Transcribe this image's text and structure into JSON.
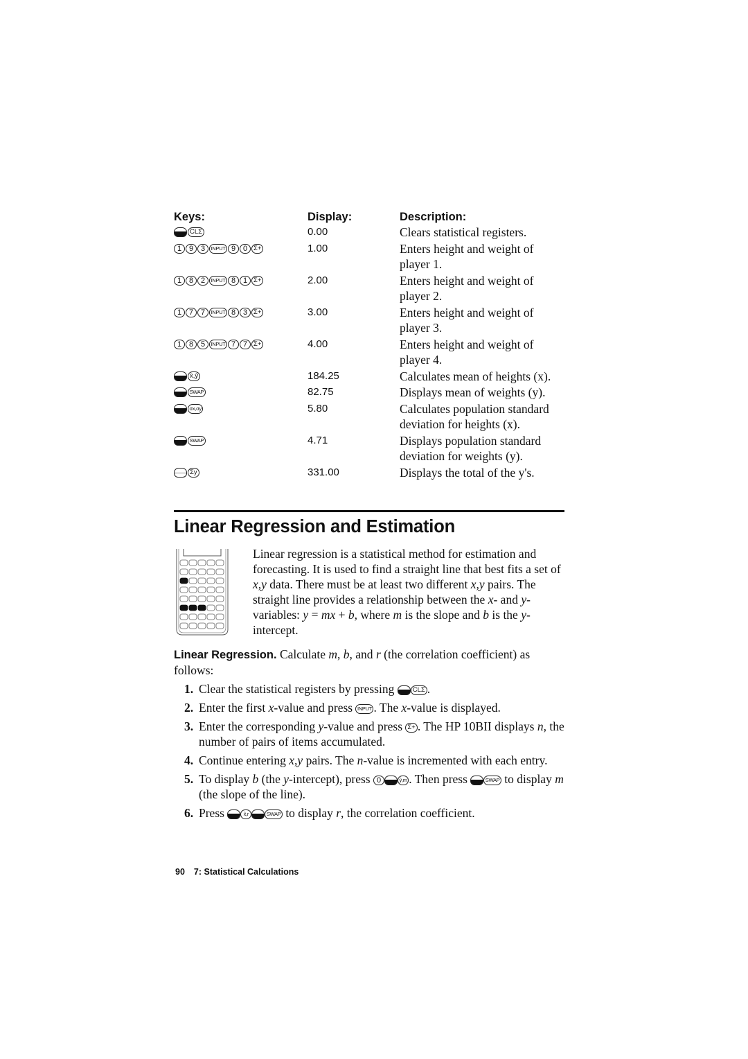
{
  "table": {
    "headers": {
      "keys": "Keys:",
      "display": "Display:",
      "description": "Description:"
    },
    "rows": [
      {
        "keys": [
          {
            "type": "shift"
          },
          {
            "label": "CLΣ",
            "size": "mid"
          }
        ],
        "display": "0.00",
        "description": "Clears statistical registers."
      },
      {
        "keys": [
          {
            "label": "1"
          },
          {
            "label": "9"
          },
          {
            "label": "3"
          },
          {
            "label": "INPUT",
            "size": "small"
          },
          {
            "label": "9"
          },
          {
            "label": "0"
          },
          {
            "label": "Σ+",
            "size": "mid"
          }
        ],
        "display": "1.00",
        "description": "Enters height and weight of player 1."
      },
      {
        "keys": [
          {
            "label": "1"
          },
          {
            "label": "8"
          },
          {
            "label": "2"
          },
          {
            "label": "INPUT",
            "size": "small"
          },
          {
            "label": "8"
          },
          {
            "label": "1"
          },
          {
            "label": "Σ+",
            "size": "mid"
          }
        ],
        "display": "2.00",
        "description": "Enters height and weight of player 2."
      },
      {
        "keys": [
          {
            "label": "1"
          },
          {
            "label": "7"
          },
          {
            "label": "7"
          },
          {
            "label": "INPUT",
            "size": "small"
          },
          {
            "label": "8"
          },
          {
            "label": "3"
          },
          {
            "label": "Σ+",
            "size": "mid"
          }
        ],
        "display": "3.00",
        "description": "Enters height and weight of player 3."
      },
      {
        "keys": [
          {
            "label": "1"
          },
          {
            "label": "8"
          },
          {
            "label": "5"
          },
          {
            "label": "INPUT",
            "size": "small"
          },
          {
            "label": "7"
          },
          {
            "label": "7"
          },
          {
            "label": "Σ+",
            "size": "mid"
          }
        ],
        "display": "4.00",
        "description": "Enters height and weight of player 4."
      },
      {
        "keys": [
          {
            "type": "shift"
          },
          {
            "label": "x̄,ȳ",
            "size": "mid"
          }
        ],
        "display": "184.25",
        "description": "Calculates mean of heights (x)."
      },
      {
        "keys": [
          {
            "type": "shift"
          },
          {
            "label": "SWAP",
            "size": "small"
          }
        ],
        "display": "82.75",
        "description": "Displays mean of weights (y)."
      },
      {
        "keys": [
          {
            "type": "shift"
          },
          {
            "label": "σx,σy",
            "size": "small"
          }
        ],
        "display": "5.80",
        "description": "Calculates population standard deviation for heights (x)."
      },
      {
        "keys": [
          {
            "type": "shift"
          },
          {
            "label": "SWAP",
            "size": "small"
          }
        ],
        "display": "4.71",
        "description": "Displays population standard deviation for weights (y)."
      },
      {
        "keys": [
          {
            "type": "shift-white"
          },
          {
            "label": "Σy",
            "size": "mid"
          }
        ],
        "display": "331.00",
        "description": "Displays the total of the y's."
      }
    ]
  },
  "section": {
    "title": "Linear Regression and Estimation",
    "intro": [
      {
        "t": "Linear regression is a statistical method for estimation and forecasting. It is used to find a straight line that best fits a set of "
      },
      {
        "i": "x,y"
      },
      {
        "t": " data. There must be at least two different "
      },
      {
        "i": "x,y"
      },
      {
        "t": " pairs. The straight line provides a relationship between the "
      },
      {
        "i": "x"
      },
      {
        "t": "- and "
      },
      {
        "i": "y"
      },
      {
        "t": "-variables: "
      },
      {
        "i": "y"
      },
      {
        "t": " = "
      },
      {
        "i": "mx"
      },
      {
        "t": " + "
      },
      {
        "i": "b"
      },
      {
        "t": ", where "
      },
      {
        "i": "m"
      },
      {
        "t": " is the slope and "
      },
      {
        "i": "b"
      },
      {
        "t": " is the "
      },
      {
        "i": "y"
      },
      {
        "t": "-intercept."
      }
    ],
    "calculator_figure": {
      "rows": 8,
      "cols": 5,
      "highlighted_keys": [
        [
          2,
          0
        ],
        [
          5,
          0
        ],
        [
          5,
          1
        ],
        [
          5,
          2
        ]
      ]
    }
  },
  "linear_regression": {
    "lead_bold": "Linear Regression.",
    "lead": [
      {
        "t": " Calculate "
      },
      {
        "i": "m"
      },
      {
        "t": ", "
      },
      {
        "i": "b"
      },
      {
        "t": ", and "
      },
      {
        "i": "r"
      },
      {
        "t": " (the correlation coefficient) as follows:"
      }
    ],
    "steps": [
      {
        "num": "1.",
        "parts": [
          {
            "t": "Clear the statistical registers by pressing "
          },
          {
            "k": "shift"
          },
          {
            "k": "CLΣ",
            "size": "mid"
          },
          {
            "t": "."
          }
        ]
      },
      {
        "num": "2.",
        "parts": [
          {
            "t": "Enter the first "
          },
          {
            "i": "x"
          },
          {
            "t": "-value and press "
          },
          {
            "k": "INPUT",
            "size": "small"
          },
          {
            "t": ". The "
          },
          {
            "i": "x"
          },
          {
            "t": "-value is displayed."
          }
        ]
      },
      {
        "num": "3.",
        "parts": [
          {
            "t": "Enter the corresponding "
          },
          {
            "i": "y"
          },
          {
            "t": "-value and press "
          },
          {
            "k": "Σ+",
            "size": "mid"
          },
          {
            "t": ". The HP 10BII displays "
          },
          {
            "i": "n"
          },
          {
            "t": ", the number of pairs of items accumulated."
          }
        ]
      },
      {
        "num": "4.",
        "parts": [
          {
            "t": "Continue entering "
          },
          {
            "i": "x,y"
          },
          {
            "t": " pairs. The "
          },
          {
            "i": "n"
          },
          {
            "t": "-value is incremented with each entry."
          }
        ]
      },
      {
        "num": "5.",
        "parts": [
          {
            "t": "To display "
          },
          {
            "i": "b"
          },
          {
            "t": " (the "
          },
          {
            "i": "y"
          },
          {
            "t": "-intercept), press "
          },
          {
            "k": "0"
          },
          {
            "k": "shift"
          },
          {
            "k": "ŷ,m",
            "size": "small"
          },
          {
            "t": ". Then press "
          },
          {
            "k": "shift"
          },
          {
            "k": "SWAP",
            "size": "small"
          },
          {
            "t": " to display "
          },
          {
            "i": "m"
          },
          {
            "t": " (the slope of the line)."
          }
        ]
      },
      {
        "num": "6.",
        "parts": [
          {
            "t": "Press "
          },
          {
            "k": "shift"
          },
          {
            "k": "x̂,r",
            "size": "small"
          },
          {
            "k": "shift"
          },
          {
            "k": "SWAP",
            "size": "small"
          },
          {
            "t": " to display "
          },
          {
            "i": "r"
          },
          {
            "t": ", the correlation coefficient."
          }
        ]
      }
    ]
  },
  "footer": {
    "page_number": "90",
    "chapter": "7: Statistical Calculations"
  }
}
